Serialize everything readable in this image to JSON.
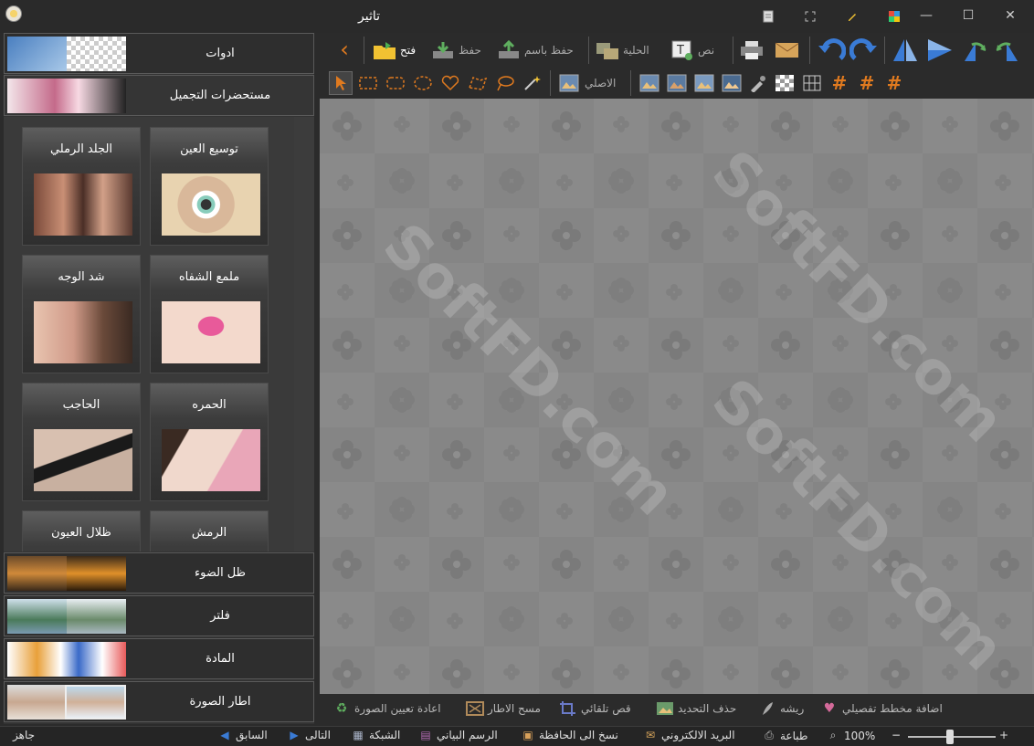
{
  "window": {
    "title": "تاثير",
    "controls": {
      "minimize": "—",
      "maximize": "☐",
      "close": "✕"
    }
  },
  "titlebar_icons": [
    "document-icon",
    "fullscreen-icon",
    "pencil-icon",
    "palette-icon"
  ],
  "toolbar": {
    "open": "فتح",
    "save": "حفظ",
    "save_as": "حفظ باسم",
    "style": "الحلية",
    "text": "نص",
    "original": "الاصلي"
  },
  "left_panel": {
    "categories_top": [
      {
        "label": "ادوات"
      },
      {
        "label": "مستحضرات التجميل"
      }
    ],
    "tiles": [
      {
        "label": "توسيع العين"
      },
      {
        "label": "الجلد الرملي"
      },
      {
        "label": "ملمع الشفاه"
      },
      {
        "label": "شد الوجه"
      },
      {
        "label": "الحمره"
      },
      {
        "label": "الحاجب"
      },
      {
        "label": "الرمش"
      },
      {
        "label": "ظلال العيون"
      }
    ],
    "categories_bottom": [
      {
        "label": "ظل الضوء"
      },
      {
        "label": "فلتر"
      },
      {
        "label": "المادة"
      },
      {
        "label": "اطار الصورة"
      }
    ]
  },
  "canvas": {
    "watermark": "SoftFD.com"
  },
  "bottom_tools": {
    "add_detail": "اضافة مخطط تفصيلي",
    "feather": "ريشه",
    "delete_selection": "حذف التحديد",
    "auto_crop": "قص تلقائي",
    "clear_frame": "مسح الاطار",
    "reset_image": "اعادة تعيين الصورة"
  },
  "status": {
    "ready": "جاهز",
    "previous": "السابق",
    "next": "التالى",
    "grid": "الشبكة",
    "chart": "الرسم البياني",
    "copy_clipboard": "نسخ الى الحافظة",
    "email": "البريد الالكتروني",
    "print": "طباعة",
    "zoom": "100%",
    "zoom_minus": "−",
    "zoom_plus": "+"
  },
  "colors": {
    "background": "#2b2b2b",
    "canvas": "#8a8a8a",
    "accent_blue": "#3a7bd5",
    "accent_orange": "#e07a1f"
  }
}
